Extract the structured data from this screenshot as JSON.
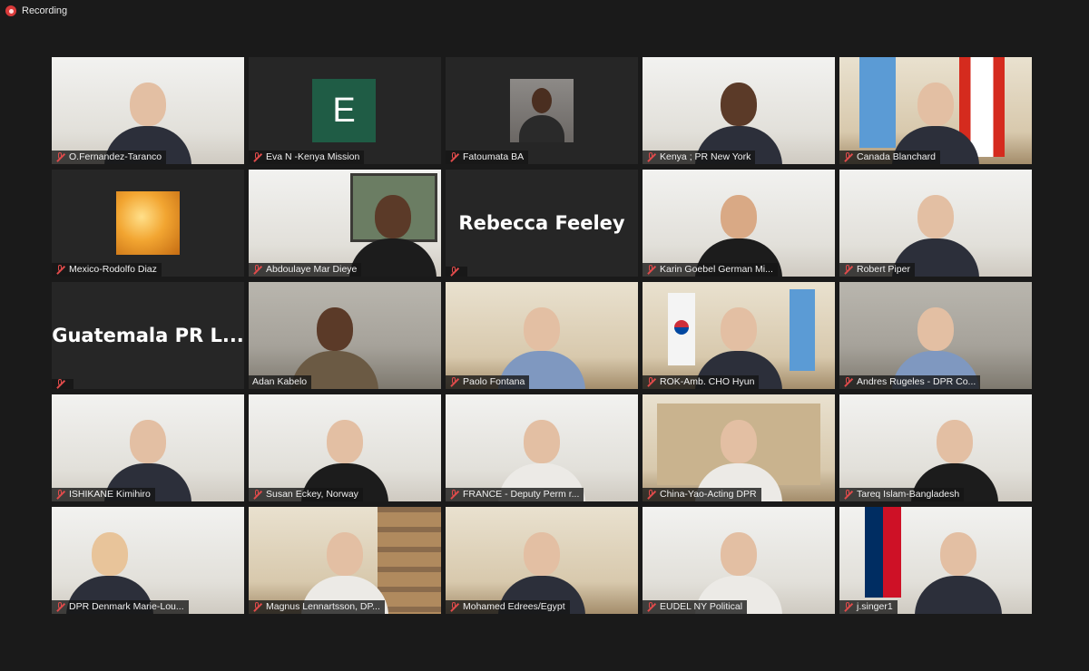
{
  "recording": {
    "label": "Recording"
  },
  "big_names": {
    "rebecca": "Rebecca Feeley",
    "guatemala": "Guatemala PR L..."
  },
  "avatars": {
    "eva_letter": "E"
  },
  "participants": [
    {
      "name": "O.Fernandez-Taranco",
      "muted": true,
      "active": false
    },
    {
      "name": "Eva N -Kenya Mission",
      "muted": true,
      "active": false
    },
    {
      "name": "Fatoumata BA",
      "muted": true,
      "active": false
    },
    {
      "name": "Kenya ; PR New York",
      "muted": true,
      "active": false
    },
    {
      "name": "Canada Blanchard",
      "muted": true,
      "active": false
    },
    {
      "name": "Mexico-Rodolfo Diaz",
      "muted": true,
      "active": false
    },
    {
      "name": "Abdoulaye Mar Dieye",
      "muted": true,
      "active": false
    },
    {
      "name": "",
      "muted": true,
      "active": false
    },
    {
      "name": "Karin Goebel German Mi...",
      "muted": true,
      "active": false
    },
    {
      "name": "Robert Piper",
      "muted": true,
      "active": false
    },
    {
      "name": "",
      "muted": true,
      "active": false
    },
    {
      "name": "Adan Kabelo",
      "muted": false,
      "active": true
    },
    {
      "name": "Paolo Fontana",
      "muted": true,
      "active": false
    },
    {
      "name": "ROK-Amb. CHO Hyun",
      "muted": true,
      "active": false
    },
    {
      "name": "Andres Rugeles - DPR Co...",
      "muted": true,
      "active": false
    },
    {
      "name": "ISHIKANE Kimihiro",
      "muted": true,
      "active": false
    },
    {
      "name": "Susan Eckey, Norway",
      "muted": true,
      "active": false
    },
    {
      "name": "FRANCE - Deputy Perm r...",
      "muted": true,
      "active": false
    },
    {
      "name": "China-Yao-Acting DPR",
      "muted": true,
      "active": false
    },
    {
      "name": "Tareq Islam-Bangladesh",
      "muted": true,
      "active": false
    },
    {
      "name": "DPR Denmark Marie-Lou...",
      "muted": true,
      "active": false
    },
    {
      "name": "Magnus Lennartsson, DP...",
      "muted": true,
      "active": false
    },
    {
      "name": "Mohamed Edrees/Egypt",
      "muted": true,
      "active": false
    },
    {
      "name": "EUDEL NY Political",
      "muted": true,
      "active": false
    },
    {
      "name": "j.singer1",
      "muted": true,
      "active": false
    }
  ],
  "colors": {
    "background": "#1a1a1a",
    "active_border": "#b8e06a",
    "muted_icon": "#e04b4b"
  }
}
